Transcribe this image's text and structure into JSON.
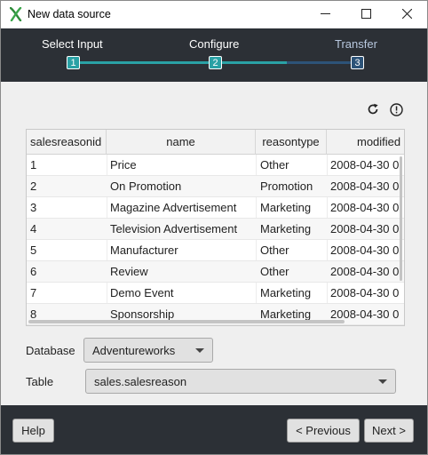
{
  "window": {
    "title": "New data source",
    "app_icon": "x-logo-icon",
    "controls": [
      "minimize-icon",
      "maximize-icon",
      "close-icon"
    ]
  },
  "wizard": {
    "steps": [
      {
        "label": "Select Input",
        "number": "1"
      },
      {
        "label": "Configure",
        "number": "2"
      },
      {
        "label": "Transfer",
        "number": "3"
      }
    ],
    "colors": {
      "background": "#2c3036",
      "active": "#2aa1a5",
      "inactive": "#2d5378"
    }
  },
  "toolbar": {
    "refresh_icon": "refresh-icon",
    "info_icon": "info-icon"
  },
  "table": {
    "columns": [
      "salesreasonid",
      "name",
      "reasontype",
      "modified"
    ],
    "rows": [
      [
        "1",
        "Price",
        "Other",
        "2008-04-30 0"
      ],
      [
        "2",
        "On Promotion",
        "Promotion",
        "2008-04-30 0"
      ],
      [
        "3",
        "Magazine Advertisement",
        "Marketing",
        "2008-04-30 0"
      ],
      [
        "4",
        "Television  Advertisement",
        "Marketing",
        "2008-04-30 0"
      ],
      [
        "5",
        "Manufacturer",
        "Other",
        "2008-04-30 0"
      ],
      [
        "6",
        "Review",
        "Other",
        "2008-04-30 0"
      ],
      [
        "7",
        "Demo Event",
        "Marketing",
        "2008-04-30 0"
      ],
      [
        "8",
        "Sponsorship",
        "Marketing",
        "2008-04-30 0"
      ]
    ]
  },
  "form": {
    "database_label": "Database",
    "database_value": "Adventureworks",
    "table_label": "Table",
    "table_value": "sales.salesreason"
  },
  "footer": {
    "help_label": "Help",
    "previous_label": "< Previous",
    "next_label": "Next >"
  }
}
